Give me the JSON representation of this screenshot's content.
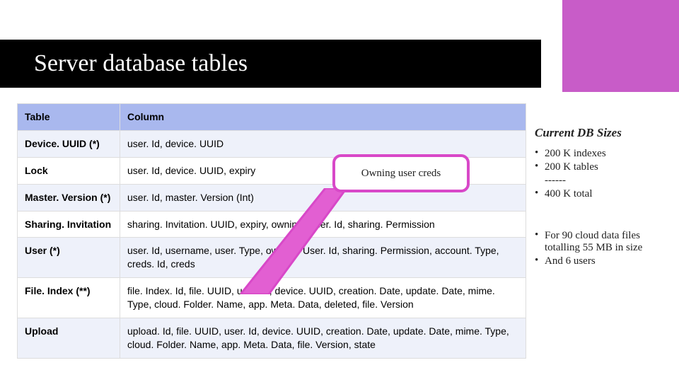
{
  "title": "Server database tables",
  "table": {
    "headers": [
      "Table",
      "Column"
    ],
    "rows": [
      {
        "name": "Device. UUID (*)",
        "cols": "user. Id, device. UUID"
      },
      {
        "name": "Lock",
        "cols": "user. Id, device. UUID, expiry"
      },
      {
        "name": "Master. Version (*)",
        "cols": "user. Id, master. Version (Int)"
      },
      {
        "name": "Sharing. Invitation",
        "cols": "sharing. Invitation. UUID, expiry, owning. User. Id, sharing. Permission"
      },
      {
        "name": "User (*)",
        "cols": "user. Id, username, user. Type, owning. User. Id, sharing. Permission, account. Type, creds. Id, creds"
      },
      {
        "name": "File. Index (**)",
        "cols": "file. Index. Id, file. UUID, user. Id, device. UUID, creation. Date, update. Date, mime. Type, cloud. Folder. Name, app. Meta. Data, deleted, file. Version"
      },
      {
        "name": "Upload",
        "cols": "upload. Id, file. UUID, user. Id, device. UUID, creation. Date, update. Date, mime. Type, cloud. Folder. Name, app. Meta. Data, file. Version, state"
      }
    ]
  },
  "callout": "Owning user creds",
  "sizes_heading": "Current DB Sizes",
  "sizes_group1": [
    "200 K indexes",
    "200 K tables",
    "------",
    "400 K total"
  ],
  "sizes_group2": [
    "For 90 cloud data files totalling 55 MB in size",
    "And 6 users"
  ],
  "colors": {
    "accent": "#c85cc8",
    "callout_border": "#d848c8",
    "header_row": "#a9b8ee"
  }
}
